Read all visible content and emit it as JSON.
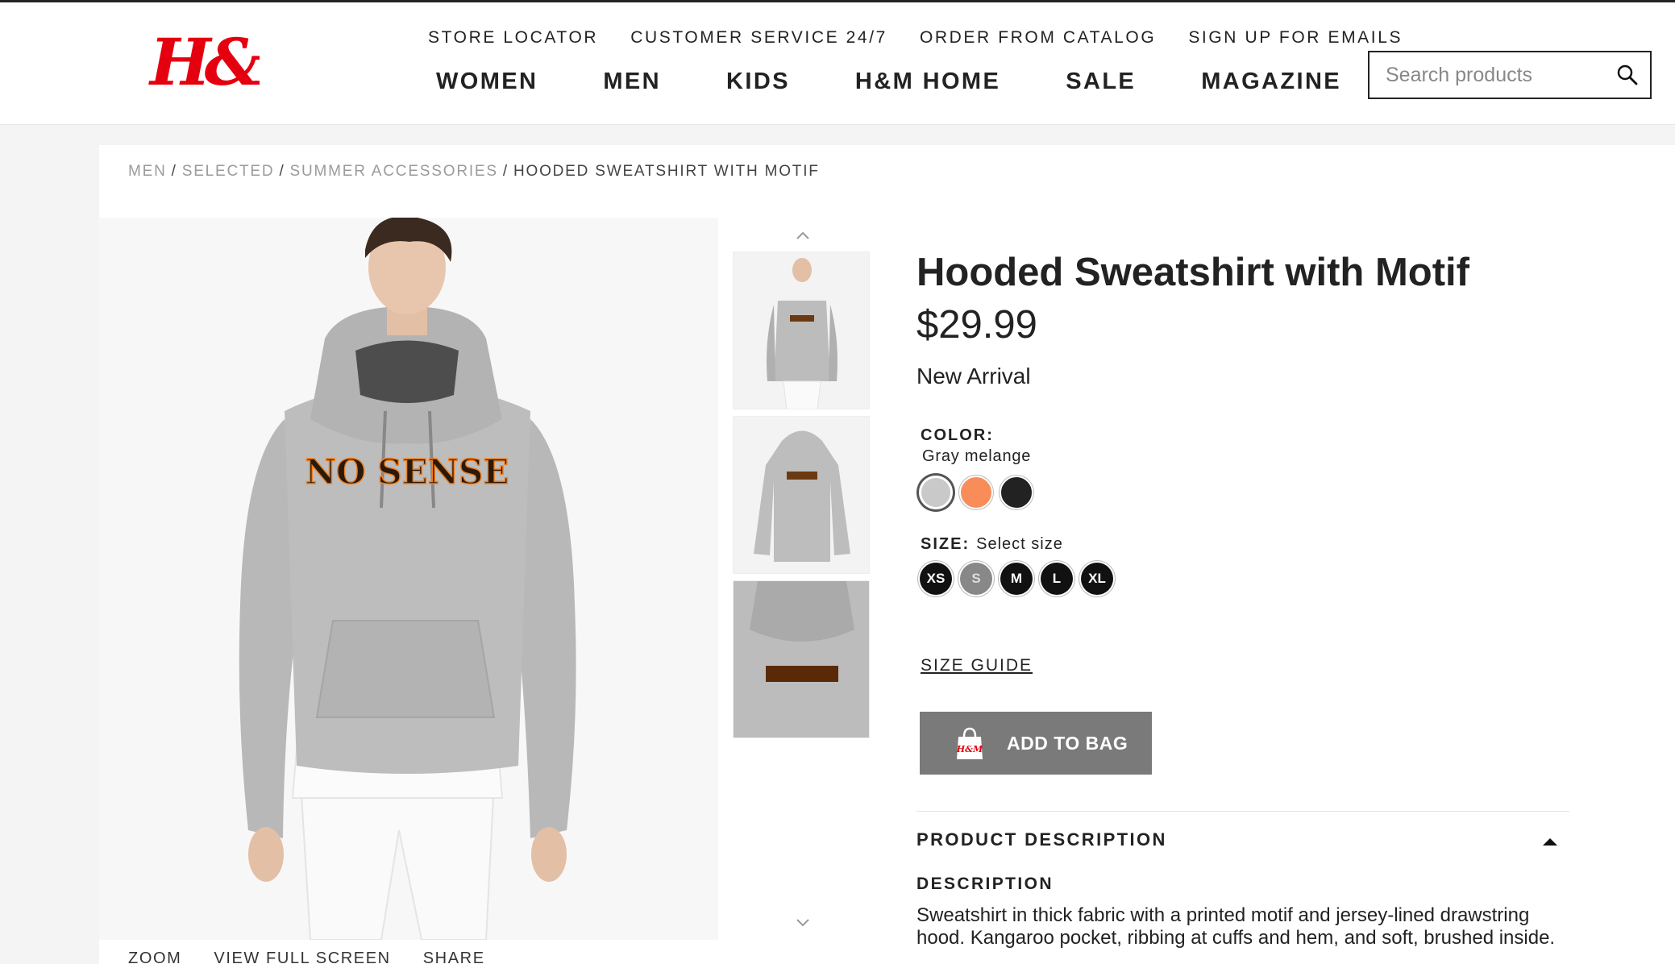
{
  "brand": {
    "logo_text": "H&M",
    "accent": "#e50010"
  },
  "utility_nav": [
    "STORE LOCATOR",
    "CUSTOMER SERVICE 24/7",
    "ORDER FROM CATALOG",
    "SIGN UP FOR EMAILS"
  ],
  "main_nav": [
    "WOMEN",
    "MEN",
    "KIDS",
    "H&M HOME",
    "SALE",
    "MAGAZINE"
  ],
  "search": {
    "placeholder": "Search products",
    "icon": "search-icon"
  },
  "breadcrumb": {
    "items": [
      "MEN",
      "SELECTED",
      "SUMMER ACCESSORIES"
    ],
    "separator": "/",
    "current": "HOODED SWEATSHIRT WITH MOTIF"
  },
  "product": {
    "title": "Hooded Sweatshirt with Motif",
    "price": "$29.99",
    "badge": "New Arrival",
    "color_label": "COLOR:",
    "color_value": "Gray melange",
    "swatches": [
      {
        "name": "gray-melange",
        "color": "#c9c9c9",
        "selected": true
      },
      {
        "name": "orange",
        "color": "#f98d5a",
        "selected": false
      },
      {
        "name": "black",
        "color": "#222222",
        "selected": false
      }
    ],
    "size_label": "SIZE:",
    "size_prompt": "Select size",
    "sizes": [
      {
        "label": "XS",
        "available": true
      },
      {
        "label": "S",
        "available": false
      },
      {
        "label": "M",
        "available": true
      },
      {
        "label": "L",
        "available": true
      },
      {
        "label": "XL",
        "available": true
      }
    ],
    "size_guide": "SIZE GUIDE",
    "add_to_bag": "ADD TO BAG",
    "bag_icon_text": "H&M",
    "description_header": "PRODUCT DESCRIPTION",
    "description_sub": "DESCRIPTION",
    "description_text": "Sweatshirt in thick fabric with a printed motif and jersey-lined drawstring hood. Kangaroo pocket, ribbing at cuffs and hem, and soft, brushed inside.",
    "print_text": "NO SENSE"
  },
  "image_tools": [
    "ZOOM",
    "VIEW FULL SCREEN",
    "SHARE"
  ]
}
